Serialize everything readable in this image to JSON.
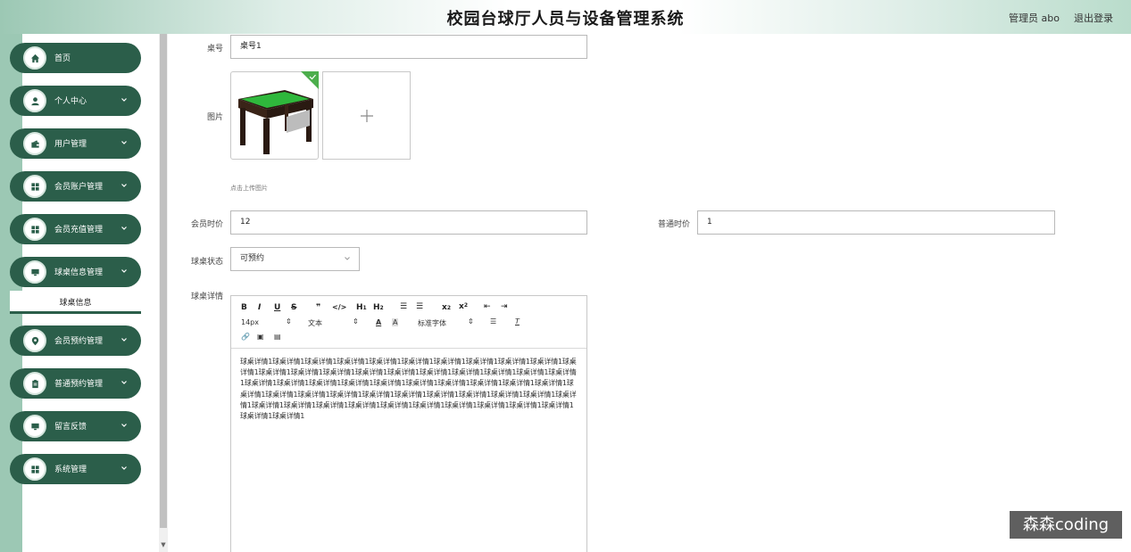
{
  "header": {
    "title": "校园台球厅人员与设备管理系统",
    "user": "管理员 abo",
    "logout": "退出登录"
  },
  "sidebar": {
    "items": [
      {
        "label": "首页",
        "icon": "home-icon"
      },
      {
        "label": "个人中心",
        "icon": "user-icon"
      },
      {
        "label": "用户管理",
        "icon": "wallet-icon"
      },
      {
        "label": "会员账户管理",
        "icon": "grid-icon"
      },
      {
        "label": "会员充值管理",
        "icon": "grid-icon"
      },
      {
        "label": "球桌信息管理",
        "icon": "monitor-icon"
      },
      {
        "label": "会员预约管理",
        "icon": "location-icon"
      },
      {
        "label": "普通预约管理",
        "icon": "clipboard-icon"
      },
      {
        "label": "留言反馈",
        "icon": "monitor-icon"
      },
      {
        "label": "系统管理",
        "icon": "grid-icon"
      }
    ],
    "active_sub": "球桌信息"
  },
  "form": {
    "table_no_label": "桌号",
    "table_no_value": "桌号1",
    "image_label": "图片",
    "upload_hint": "点击上传图片",
    "member_price_label": "会员时价",
    "member_price_value": "12",
    "normal_price_label": "普通时价",
    "normal_price_value": "1",
    "status_label": "球桌状态",
    "status_value": "可预约",
    "detail_label": "球桌详情"
  },
  "editor": {
    "font_size": "14px",
    "block_type": "文本",
    "font_family": "标准字体",
    "content": "球桌详情1球桌详情1球桌详情1球桌详情1球桌详情1球桌详情1球桌详情1球桌详情1球桌详情1球桌详情1球桌详情1球桌详情1球桌详情1球桌详情1球桌详情1球桌详情1球桌详情1球桌详情1球桌详情1球桌详情1球桌详情1球桌详情1球桌详情1球桌详情1球桌详情1球桌详情1球桌详情1球桌详情1球桌详情1球桌详情1球桌详情1球桌详情1球桌详情1球桌详情1球桌详情1球桌详情1球桌详情1球桌详情1球桌详情1球桌详情1球桌详情1球桌详情1球桌详情1球桌详情1球桌详情1球桌详情1球桌详情1球桌详情1球桌详情1球桌详情1球桌详情1球桌详情1球桌详情1球桌详情1"
  },
  "watermark": "森森coding",
  "colors": {
    "primary": "#2b5e4a",
    "strip": "#9cc8b4"
  }
}
